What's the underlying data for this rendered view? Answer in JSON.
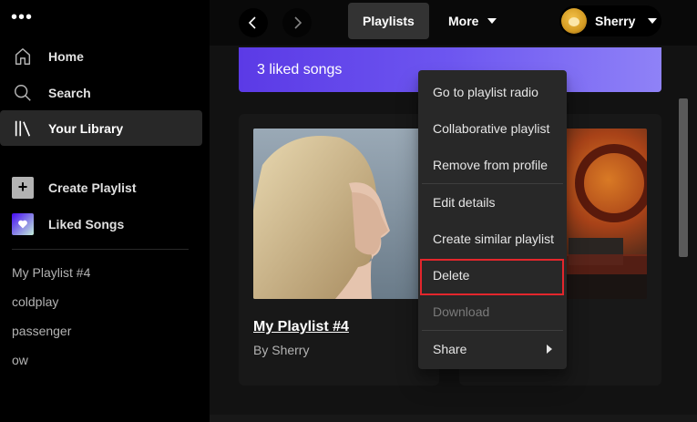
{
  "sidebar": {
    "menu_dots": "•••",
    "nav": [
      {
        "label": "Home",
        "icon": "home-icon"
      },
      {
        "label": "Search",
        "icon": "search-icon"
      },
      {
        "label": "Your Library",
        "icon": "library-icon"
      }
    ],
    "create_playlist": "Create Playlist",
    "liked_songs": "Liked Songs",
    "playlists": [
      "My Playlist #4",
      "coldplay",
      "passenger",
      "ow"
    ]
  },
  "topbar": {
    "tabs": [
      "Playlists",
      "More"
    ],
    "user_name": "Sherry"
  },
  "main": {
    "liked_banner": "3 liked songs",
    "cards": [
      {
        "title": "My Playlist #4",
        "subtitle": "By Sherry"
      }
    ]
  },
  "context_menu": {
    "items": [
      "Go to playlist radio",
      "Collaborative playlist",
      "Remove from profile",
      "Edit details",
      "Create similar playlist",
      "Delete",
      "Download",
      "Share"
    ],
    "highlight_color": "#e3262c"
  },
  "colors": {
    "sidebar_bg": "#000000",
    "main_bg": "#121212",
    "card_bg": "#181818",
    "menu_bg": "#282828",
    "banner_accent": "#5b3ae6"
  }
}
